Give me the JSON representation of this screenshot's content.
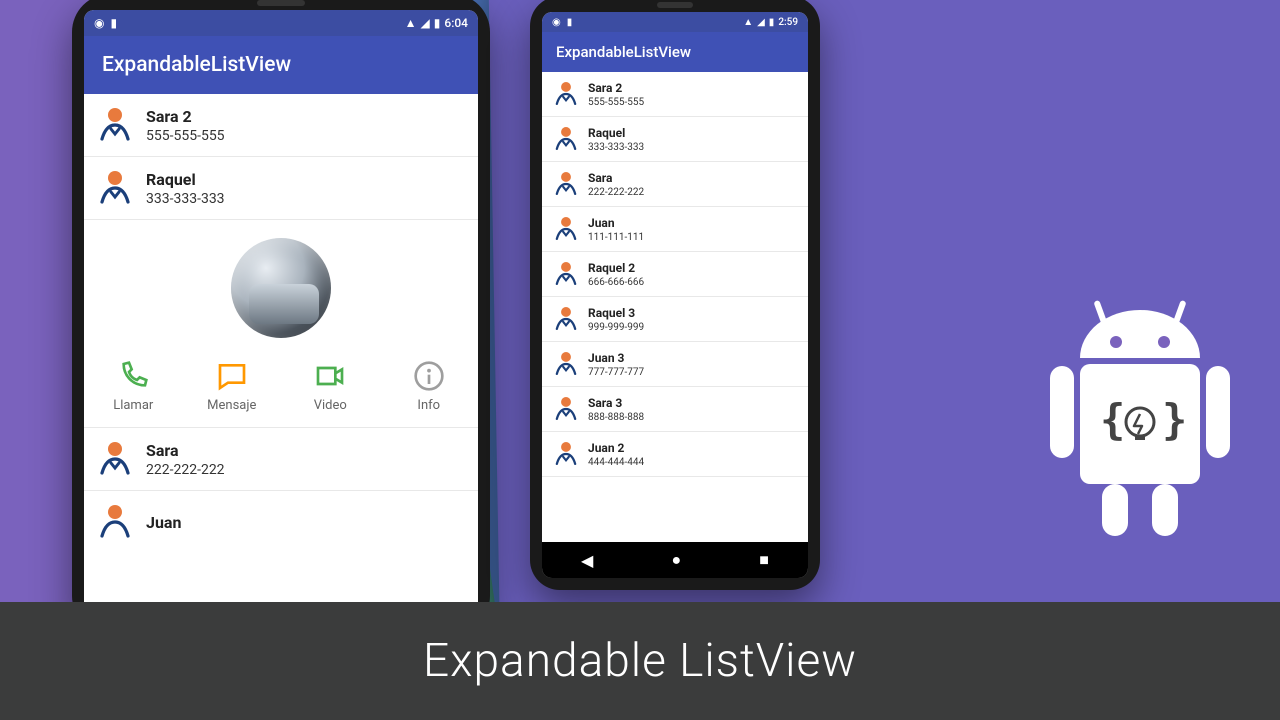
{
  "banner_title": "Expandable ListView",
  "app_title": "ExpandableListView",
  "statusbar_time_large": "6:04",
  "statusbar_time_small": "2:59",
  "actions": {
    "call": "Llamar",
    "message": "Mensaje",
    "video": "Video",
    "info": "Info"
  },
  "large_phone": {
    "contacts": [
      {
        "name": "Sara 2",
        "phone": "555-555-555",
        "expanded": false
      },
      {
        "name": "Raquel",
        "phone": "333-333-333",
        "expanded": true
      },
      {
        "name": "Sara",
        "phone": "222-222-222",
        "expanded": false
      },
      {
        "name": "Juan",
        "phone": "",
        "expanded": false
      }
    ]
  },
  "small_phone": {
    "contacts": [
      {
        "name": "Sara 2",
        "phone": "555-555-555"
      },
      {
        "name": "Raquel",
        "phone": "333-333-333"
      },
      {
        "name": "Sara",
        "phone": "222-222-222"
      },
      {
        "name": "Juan",
        "phone": "111-111-111"
      },
      {
        "name": "Raquel 2",
        "phone": "666-666-666"
      },
      {
        "name": "Raquel 3",
        "phone": "999-999-999"
      },
      {
        "name": "Juan 3",
        "phone": "777-777-777"
      },
      {
        "name": "Sara 3",
        "phone": "888-888-888"
      },
      {
        "name": "Juan 2",
        "phone": "444-444-444"
      }
    ]
  }
}
